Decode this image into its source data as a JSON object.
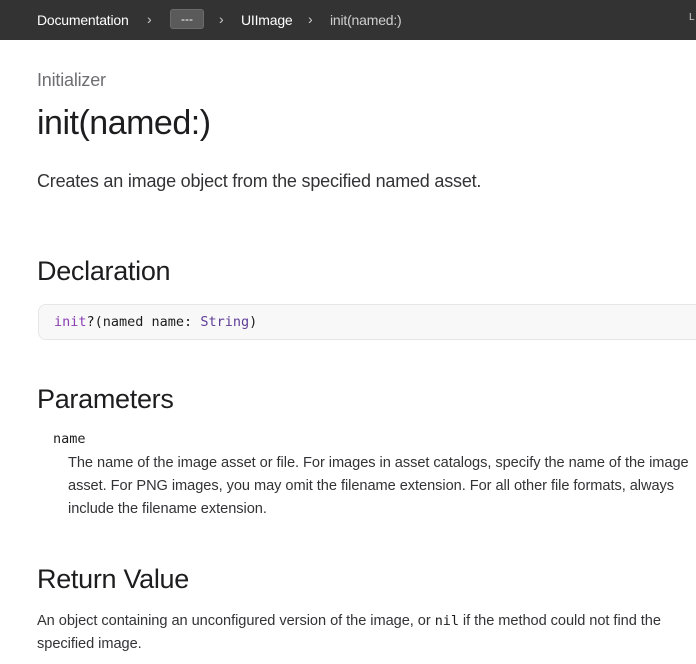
{
  "breadcrumb": {
    "items": [
      {
        "label": "Documentation"
      },
      {
        "label": "---"
      },
      {
        "label": "UIImage"
      },
      {
        "label": "init(named:)"
      }
    ],
    "separator": "›",
    "edge_text": "L"
  },
  "header": {
    "eyebrow": "Initializer",
    "title": "init(named:)",
    "abstract": "Creates an image object from the specified named asset."
  },
  "declaration": {
    "heading": "Declaration",
    "code": {
      "keyword": "init",
      "mid": "?(named name: ",
      "type": "String",
      "end": ")"
    }
  },
  "parameters": {
    "heading": "Parameters",
    "items": [
      {
        "name": "name",
        "description": "The name of the image asset or file. For images in asset catalogs, specify the name of the image asset. For PNG images, you may omit the filename extension. For all other file formats, always include the filename extension."
      }
    ]
  },
  "return_value": {
    "heading": "Return Value",
    "text_before": "An object containing an unconfigured version of the image, or ",
    "code": "nil",
    "text_after": " if the method could not find the specified image."
  },
  "colors": {
    "topbar_bg": "#333333",
    "keyword": "#8a3fb2",
    "type": "#5f3c96"
  }
}
